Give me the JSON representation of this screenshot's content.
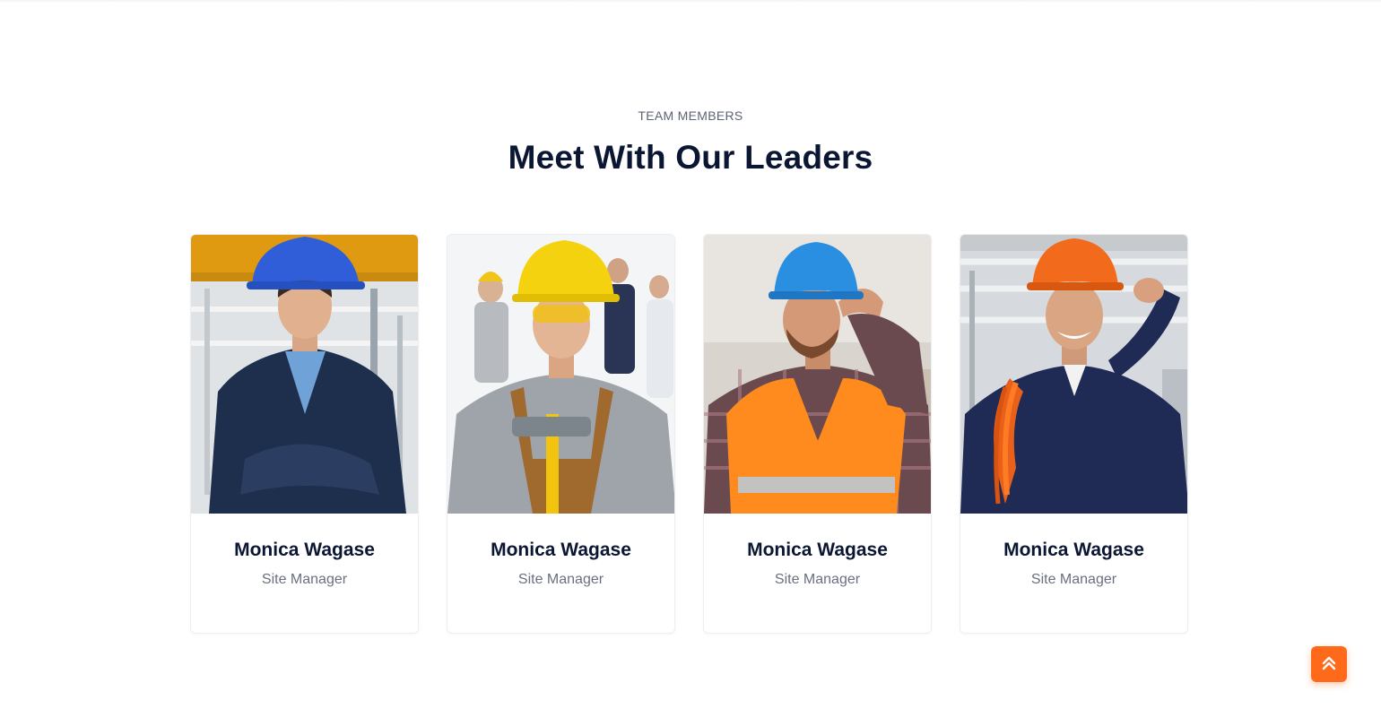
{
  "section": {
    "eyebrow": "TEAM MEMBERS",
    "title": "Meet With Our Leaders"
  },
  "team": [
    {
      "name": "Monica Wagase",
      "role": "Site Manager",
      "helmet_color": "#2f5ed8",
      "photo": "worker-blue-helmet"
    },
    {
      "name": "Monica Wagase",
      "role": "Site Manager",
      "helmet_color": "#f5d20f",
      "photo": "worker-yellow-helmet"
    },
    {
      "name": "Monica Wagase",
      "role": "Site Manager",
      "helmet_color": "#2a8fe0",
      "photo": "worker-orange-vest"
    },
    {
      "name": "Monica Wagase",
      "role": "Site Manager",
      "helmet_color": "#f26a1b",
      "photo": "worker-orange-helmet"
    }
  ],
  "scroll_top": {
    "icon": "double-chevron-up-icon",
    "color": "#ff6a1a"
  }
}
